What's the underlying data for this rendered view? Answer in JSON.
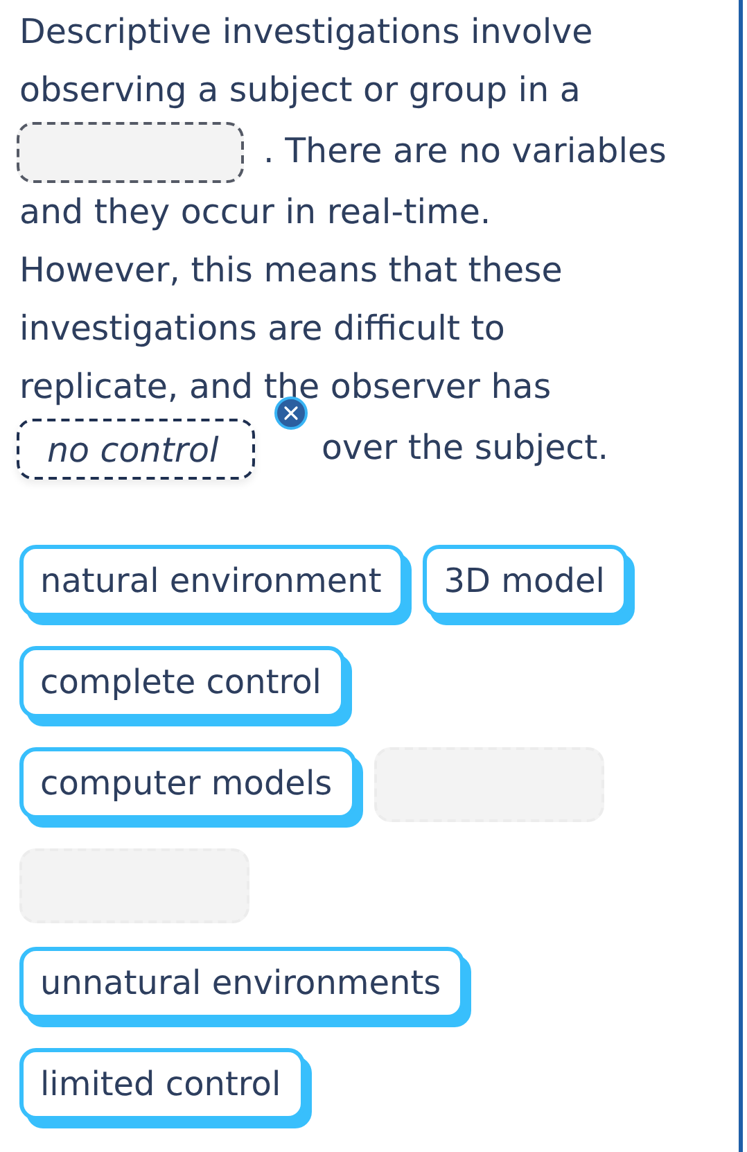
{
  "passage": {
    "lines": [
      {
        "segments": [
          {
            "kind": "text",
            "text": "Descriptive investigations involve"
          }
        ]
      },
      {
        "segments": [
          {
            "kind": "text",
            "text": "observing a subject or group in a"
          }
        ]
      },
      {
        "segments": [
          {
            "kind": "blank"
          },
          {
            "kind": "text",
            "text": ". There are no variables"
          }
        ]
      },
      {
        "segments": [
          {
            "kind": "text",
            "text": "and they occur in real-time."
          }
        ]
      },
      {
        "segments": [
          {
            "kind": "text",
            "text": "However, this means that these"
          }
        ]
      },
      {
        "segments": [
          {
            "kind": "text",
            "text": "investigations are difficult to"
          }
        ]
      },
      {
        "segments": [
          {
            "kind": "text",
            "text": "replicate, and the observer has"
          }
        ]
      },
      {
        "segments": [
          {
            "kind": "blank",
            "answer": "no control"
          },
          {
            "kind": "text",
            "text": "over the subject."
          }
        ]
      }
    ]
  },
  "options": [
    {
      "kind": "chip",
      "label": "natural environment"
    },
    {
      "kind": "chip",
      "label": "3D model"
    },
    {
      "kind": "chip",
      "label": "complete control"
    },
    {
      "kind": "chip",
      "label": "computer models"
    },
    {
      "kind": "empty"
    },
    {
      "kind": "empty"
    },
    {
      "kind": "chip",
      "label": "unnatural environments"
    },
    {
      "kind": "chip",
      "label": "limited control"
    }
  ]
}
